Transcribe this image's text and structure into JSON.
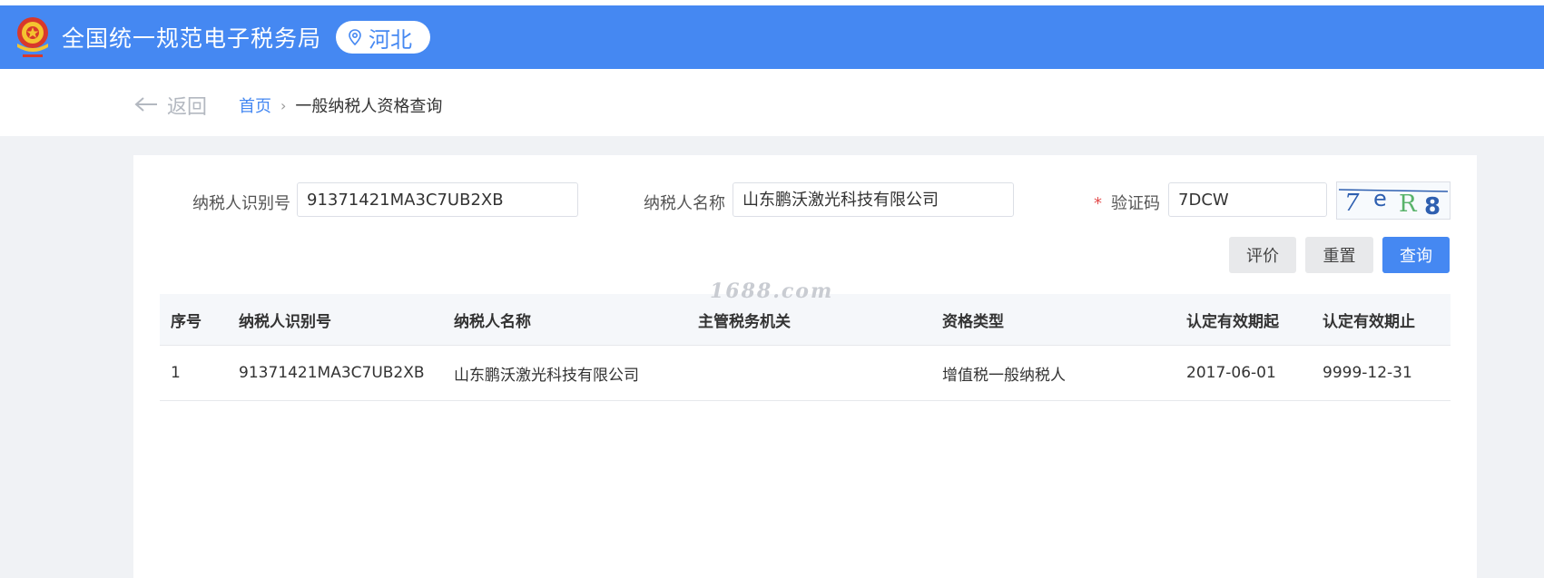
{
  "header": {
    "site_title": "全国统一规范电子税务局",
    "region": "河北"
  },
  "nav": {
    "back_label": "返回",
    "breadcrumb_home": "首页",
    "breadcrumb_separator": "›",
    "breadcrumb_current": "一般纳税人资格查询"
  },
  "form": {
    "taxpayer_id_label": "纳税人识别号",
    "taxpayer_id_value": "91371421MA3C7UB2XB",
    "taxpayer_name_label": "纳税人名称",
    "taxpayer_name_value": "山东鹏沃激光科技有限公司",
    "required_mark": "*",
    "captcha_label": "验证码",
    "captcha_value": "7DCW",
    "captcha_image_text": "7eR8"
  },
  "buttons": {
    "evaluate": "评价",
    "reset": "重置",
    "query": "查询"
  },
  "watermark": "1688.com",
  "table": {
    "headers": [
      "序号",
      "纳税人识别号",
      "纳税人名称",
      "主管税务机关",
      "资格类型",
      "认定有效期起",
      "认定有效期止"
    ],
    "rows": [
      [
        "1",
        "91371421MA3C7UB2XB",
        "山东鹏沃激光科技有限公司",
        "",
        "增值税一般纳税人",
        "2017-06-01",
        "9999-12-31"
      ]
    ]
  },
  "colors": {
    "brand_blue": "#4588f2",
    "required_red": "#e34d4d"
  }
}
